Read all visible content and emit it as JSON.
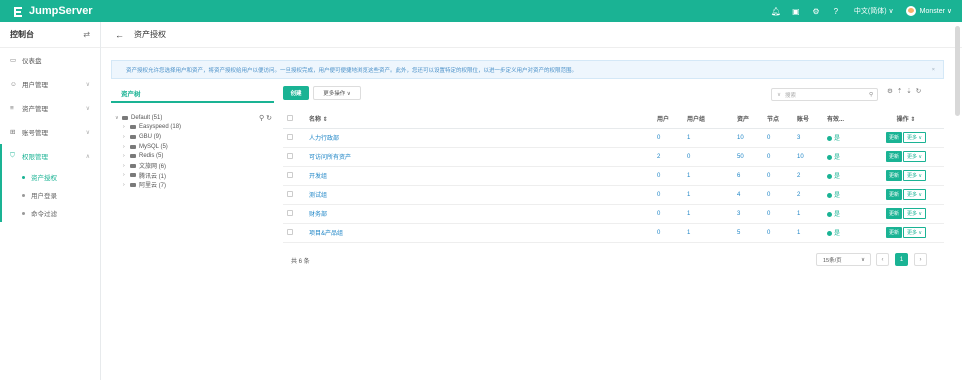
{
  "app": {
    "name": "JumpServer"
  },
  "topbar": {
    "language": "中文(简体) ∨",
    "user": "Monster ∨"
  },
  "sidebar": {
    "title": "控制台",
    "items": [
      {
        "label": "仪表盘",
        "icon": "dashboard-icon"
      },
      {
        "label": "用户管理",
        "icon": "users-icon"
      },
      {
        "label": "资产管理",
        "icon": "assets-icon"
      },
      {
        "label": "账号管理",
        "icon": "accounts-icon"
      },
      {
        "label": "权限管理",
        "icon": "permission-icon"
      }
    ],
    "subitems": [
      "资产授权",
      "用户登录",
      "命令过滤"
    ]
  },
  "page": {
    "title": "资产授权"
  },
  "notice": {
    "text": "资产授权允许您选择用户和资产，将资产授权给用户以便访问。一旦授权完成，用户便可便捷地浏览这些资产。此外，您还可以设置特定的权限位，以进一步定义用户对资产的权限范围。"
  },
  "tree": {
    "tab": "资产树",
    "root": "Default (51)",
    "nodes": [
      "Easyspeed (18)",
      "GBU (9)",
      "MySQL (5)",
      "Redis (5)",
      "文旅网 (6)",
      "腾讯云 (1)",
      "阿里云 (7)"
    ]
  },
  "toolbar": {
    "create": "创建",
    "more": "更多操作 ∨",
    "search_placeholder": "搜索"
  },
  "table": {
    "headers": [
      "名称 ⇕",
      "用户",
      "用户组",
      "资产",
      "节点",
      "账号",
      "有效...",
      "操作 ⇕"
    ],
    "rows": [
      {
        "name": "人力行政部",
        "users": "0",
        "groups": "1",
        "assets": "10",
        "nodes": "0",
        "accounts": "3",
        "valid": "是"
      },
      {
        "name": "可访问所有资产",
        "users": "2",
        "groups": "0",
        "assets": "50",
        "nodes": "0",
        "accounts": "10",
        "valid": "是"
      },
      {
        "name": "开发组",
        "users": "0",
        "groups": "1",
        "assets": "6",
        "nodes": "0",
        "accounts": "2",
        "valid": "是"
      },
      {
        "name": "测试组",
        "users": "0",
        "groups": "1",
        "assets": "4",
        "nodes": "0",
        "accounts": "2",
        "valid": "是"
      },
      {
        "name": "财务部",
        "users": "0",
        "groups": "1",
        "assets": "3",
        "nodes": "0",
        "accounts": "1",
        "valid": "是"
      },
      {
        "name": "项目&产品组",
        "users": "0",
        "groups": "1",
        "assets": "5",
        "nodes": "0",
        "accounts": "1",
        "valid": "是"
      }
    ],
    "update_label": "更新",
    "more_label": "更多 ∨"
  },
  "footer": {
    "total": "共 6 条",
    "page_size": "15条/页",
    "current_page": "1"
  },
  "colors": {
    "accent": "#1ab394",
    "link": "#1c84c6"
  }
}
